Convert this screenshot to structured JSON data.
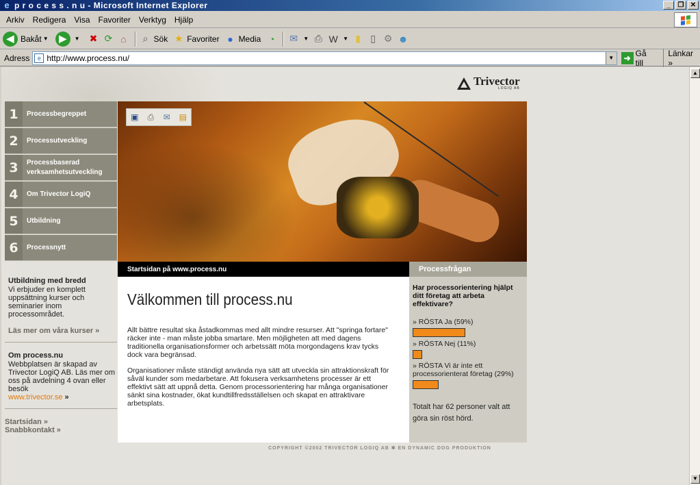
{
  "window": {
    "title": "p r o c e s s . n u - Microsoft Internet Explorer"
  },
  "menu": [
    "Arkiv",
    "Redigera",
    "Visa",
    "Favoriter",
    "Verktyg",
    "Hjälp"
  ],
  "toolbar": {
    "back": "Bakåt",
    "search": "Sök",
    "favorites": "Favoriter",
    "media": "Media"
  },
  "address": {
    "label": "Adress",
    "url": "http://www.process.nu/",
    "go": "Gå till",
    "links": "Länkar"
  },
  "site": {
    "logo": {
      "name": "Trivector",
      "sub": "LOGIQ AB"
    },
    "nav": [
      {
        "num": "1",
        "label": "Processbegreppet"
      },
      {
        "num": "2",
        "label": "Processutveckling"
      },
      {
        "num": "3",
        "label": "Processbaserad verksamhetsutveckling"
      },
      {
        "num": "4",
        "label": "Om Trivector LogiQ"
      },
      {
        "num": "5",
        "label": "Utbildning"
      },
      {
        "num": "6",
        "label": "Processnytt"
      }
    ],
    "sidebar": {
      "edu_title": "Utbildning med bredd",
      "edu_text": "Vi erbjuder en komplett uppsättning kurser och seminarier inom processområdet.",
      "edu_link": "Läs mer om våra kurser »",
      "about_title": "Om process.nu",
      "about_text": "Webbplatsen är skapad av Trivector LogiQ AB. Läs mer om oss på avdelning 4 ovan eller besök",
      "about_link": "www.trivector.se",
      "about_link_suffix": " »",
      "link_start": "Startsidan »",
      "link_contact": "Snabbkontakt »"
    },
    "main": {
      "header": "Startsidan på www.process.nu",
      "title": "Välkommen till process.nu",
      "para1": "Allt bättre resultat ska åstadkommas med allt mindre resurser. Att \"springa fortare\" räcker inte - man måste jobba smartare. Men möjligheten att med dagens traditionella organisationsformer och arbetssätt möta morgondagens krav tycks dock vara begränsad.",
      "para2": "Organisationer måste ständigt använda nya sätt att utveckla sin attraktionskraft för såväl kunder som medarbetare. Att fokusera verksamhetens processer är ett effektivt sätt att uppnå detta. Genom processorientering har många organisationer sänkt sina kostnader, ökat kundtillfredsställelsen och skapat en attraktivare arbetsplats."
    },
    "poll": {
      "header": "Processfrågan",
      "question": "Har processorientering hjälpt ditt företag att arbeta effektivare?",
      "options": [
        {
          "label": "» RÖSTA Ja (59%)",
          "percent": 59
        },
        {
          "label": "» RÖSTA Nej (11%)",
          "percent": 11
        },
        {
          "label": "» RÖSTA Vi är inte ett processorienterat företag (29%)",
          "percent": 29
        }
      ],
      "total": "Totalt har 62 personer valt att göra sin röst hörd."
    },
    "copyright": "COPYRIGHT ©2002 TRIVECTOR LOGIQ AB  ✱  EN DYNAMIC DOG PRODUKTION"
  }
}
